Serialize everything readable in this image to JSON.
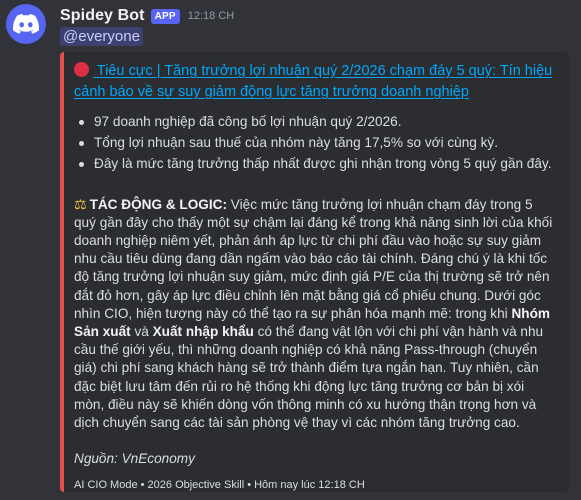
{
  "author": {
    "name": "Spidey Bot",
    "badge": "APP",
    "timestamp": "12:18 CH"
  },
  "mention": "@everyone",
  "embed": {
    "accent_color": "#e6504a",
    "title": "Tiêu cực | Tăng trưởng lợi nhuận quý 2/2026 chạm đáy 5 quý: Tín hiệu cảnh báo về sự suy giảm động lực tăng trưởng doanh nghiệp",
    "bullets": [
      "97 doanh nghiệp đã công bố lợi nhuận quý 2/2026.",
      "Tổng lợi nhuận sau thuế của nhóm này tăng 17,5% so với cùng kỳ.",
      "Đây là mức tăng trưởng thấp nhất được ghi nhận trong vòng 5 quý gần đây."
    ],
    "impact": {
      "label": "TÁC ĐỘNG & LOGIC:",
      "text_1": " Việc mức tăng trưởng lợi nhuận chạm đáy trong 5 quý gần đây cho thấy một sự chậm lại đáng kể trong khả năng sinh lời của khối doanh nghiệp niêm yết, phản ánh áp lực từ chi phí đầu vào hoặc sự suy giảm nhu cầu tiêu dùng đang dần ngấm vào báo cáo tài chính. Đáng chú ý là khi tốc độ tăng trưởng lợi nhuận suy giảm, mức định giá P/E của thị trường sẽ trở nên đắt đỏ hơn, gây áp lực điều chỉnh lên mặt bằng giá cổ phiếu chung. Dưới góc nhìn CIO, hiện tượng này có thể tạo ra sự phân hóa mạnh mẽ: trong khi ",
      "bold_1": "Nhóm Sản xuất",
      "text_2": " và ",
      "bold_2": "Xuất nhập khẩu",
      "text_3": " có thể đang vật lộn với chi phí vận hành và nhu cầu thế giới yếu, thì những doanh nghiệp có khả năng Pass-through (chuyển giá) chi phí sang khách hàng sẽ trở thành điểm tựa ngắn hạn. Tuy nhiên, cần đặc biệt lưu tâm đến rủi ro hệ thống khi động lực tăng trưởng cơ bản bị xói mòn, điều này sẽ khiến dòng vốn thông minh có xu hướng thận trọng hơn và dịch chuyển sang các tài sản phòng vệ thay vì các nhóm tăng trưởng cao."
    },
    "source": "Nguồn: VnEconomy",
    "footer": "AI CIO Mode • 2026 Objective Skill • Hôm nay lúc 12:18 CH"
  },
  "icons": {
    "avatar": "discord-logo-icon",
    "title_prefix": "red-circle-icon",
    "impact_prefix": "balance-scale-icon"
  }
}
